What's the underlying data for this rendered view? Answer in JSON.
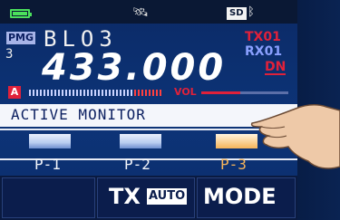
{
  "status_bar": {
    "battery_icon": "battery-full-icon",
    "gps_icon": "satellite-icon",
    "sd_label": "SD",
    "bluetooth_icon": "bluetooth-icon"
  },
  "memory": {
    "group_label": "PMG",
    "bank_number": "3",
    "name": "BLO3",
    "frequency": "433.000"
  },
  "indicators": {
    "tx": "TX01",
    "rx": "RX01",
    "mode": "DN"
  },
  "meter": {
    "band_badge": "A",
    "vol_label": "VOL",
    "vol_level": 0.45
  },
  "monitor": {
    "title": "ACTIVE MONITOR",
    "presets": [
      {
        "label": "P-1",
        "color": "#b9cdf0",
        "active": false
      },
      {
        "label": "P-2",
        "color": "#b9cdf0",
        "active": false
      },
      {
        "label": "P-3",
        "color": "#f5b45a",
        "active": true
      }
    ]
  },
  "buttons": {
    "tx_label": "TX",
    "auto_label": "AUTO",
    "mode_label": "MODE"
  },
  "colors": {
    "accent_red": "#e0213a",
    "active_orange": "#f5b45a",
    "background_blue": "#0d3478"
  }
}
